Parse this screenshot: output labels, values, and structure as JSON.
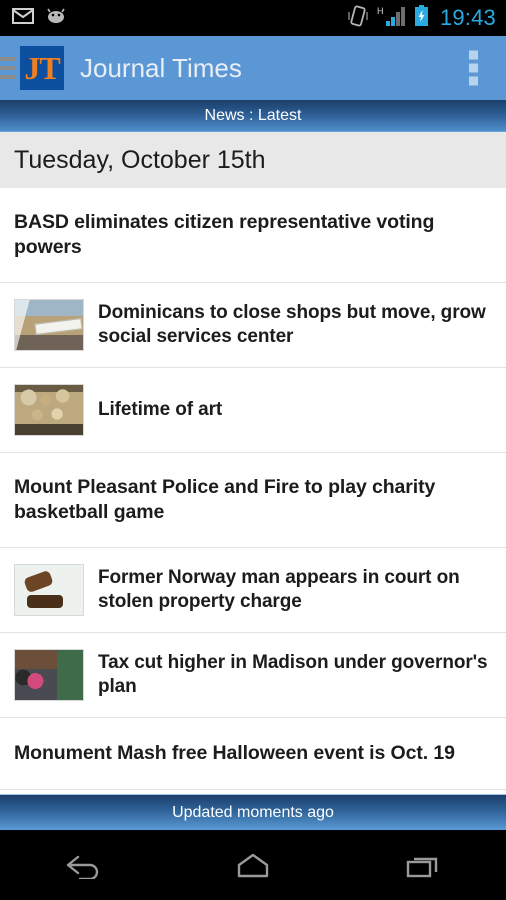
{
  "statusbar": {
    "time": "19:43",
    "icons": [
      "mail-icon",
      "android-robot-icon",
      "vibrate-icon",
      "signal-h-icon",
      "battery-charging-icon"
    ]
  },
  "actionbar": {
    "drawer_icon": "hamburger-menu-icon",
    "logo_text": "JT",
    "title": "Journal Times",
    "overflow_icon": "overflow-menu-icon",
    "bg_color": "#5b97d4",
    "logo_bg": "#0b4f9e",
    "logo_fg": "#f07f22"
  },
  "section": {
    "label": "News : Latest"
  },
  "date_header": {
    "label": "Tuesday, October 15th"
  },
  "articles": [
    {
      "headline": "BASD eliminates citizen representative voting powers",
      "thumb": null
    },
    {
      "headline": "Dominicans to close shops but move, grow social services center",
      "thumb": "th-shop"
    },
    {
      "headline": "Lifetime of art",
      "thumb": "th-art"
    },
    {
      "headline": "Mount Pleasant Police and Fire to play charity basketball game",
      "thumb": null
    },
    {
      "headline": "Former Norway man appears in court on stolen property charge",
      "thumb": "th-gavel"
    },
    {
      "headline": "Tax cut higher in Madison under governor's plan",
      "thumb": "th-class"
    },
    {
      "headline": "Monument Mash free Halloween event is Oct. 19",
      "thumb": null
    }
  ],
  "footer": {
    "status": "Updated moments ago"
  },
  "navbar": {
    "back": "back-icon",
    "home": "home-icon",
    "recents": "recents-icon"
  }
}
